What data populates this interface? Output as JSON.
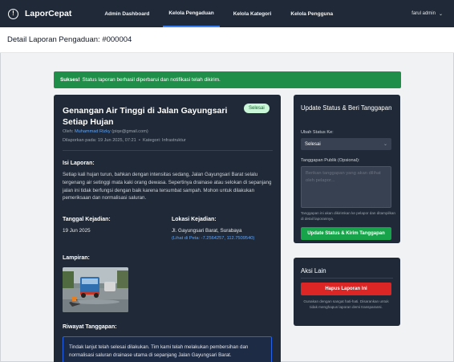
{
  "nav": {
    "brand": "LaporCepat",
    "links": [
      {
        "label": "Admin Dashboard"
      },
      {
        "label": "Kelola Pengaduan"
      },
      {
        "label": "Kelola Kategori"
      },
      {
        "label": "Kelola Pengguna"
      }
    ],
    "active_index": 1,
    "user": "farul admin"
  },
  "page": {
    "title": "Detail Laporan Pengaduan: #000004"
  },
  "alert": {
    "strong": "Sukses!",
    "message": "Status laporan berhasil diperbarui dan notifikasi telah dikirim."
  },
  "report": {
    "title": "Genangan Air Tinggi di Jalan Gayungsari Setiap Hujan",
    "status": "Selesai",
    "by_prefix": "Oleh:",
    "reporter": "Muhammad Rizky",
    "email": "(piqe@gmail.com)",
    "reported_on": "Dilaporkan pada: 19 Jun 2025, 07:21",
    "category": "Kategori: Infrastruktur",
    "description_label": "Isi Laporan:",
    "description": "Setiap kali hujan turun, bahkan dengan intensitas sedang, Jalan Gayungsari Barat selalu tergenang air setinggi mata kaki orang dewasa. Sepertinya drainase atau selokan di sepanjang jalan ini tidak berfungsi dengan baik karena tersumbat sampah. Mohon untuk dilakukan pemeriksaan dan normalisasi saluran.",
    "date_label": "Tanggal Kejadian:",
    "date_value": "19 Jun 2025",
    "location_label": "Lokasi Kejadian:",
    "location_value": "Jl. Gayungsari Barat, Surabaya",
    "map_link": "(Lihat di Peta: -7.2564257, 112.7509540)",
    "attachment_label": "Lampiran:",
    "history_label": "Riwayat Tanggapan:",
    "response_text": "Tindak lanjut telah selesai dilakukan. Tim kami telah melakukan pembersihan dan normalisasi saluran drainase utama di sepanjang Jalan Gayungsari Barat."
  },
  "update_panel": {
    "title": "Update Status & Beri Tanggapan",
    "status_label": "Ubah Status Ke:",
    "status_value": "Selesai",
    "response_label": "Tanggapan Publik (Opsional):",
    "response_placeholder": "Berikan tanggapan yang akan dilihat oleh pelapor...",
    "hint": "Tanggapan ini akan dikirimkan ke pelapor dan ditampilkan di detail laporannya.",
    "submit_label": "Update Status & Kirim Tanggapan"
  },
  "other_actions": {
    "title": "Aksi Lain",
    "delete_label": "Hapus Laporan Ini",
    "warning": "Gunakan dengan sangat hati-hati. Disarankan untuk tidak menghapus laporan demi transparansi."
  },
  "colors": {
    "navbar": "#1f2937",
    "card": "#1f2937",
    "success": "#1f8e49",
    "link": "#60a5fa",
    "primary_green": "#16a34a",
    "danger": "#dc2626",
    "badge_bg": "#c9f7d7",
    "badge_text": "#166534"
  }
}
